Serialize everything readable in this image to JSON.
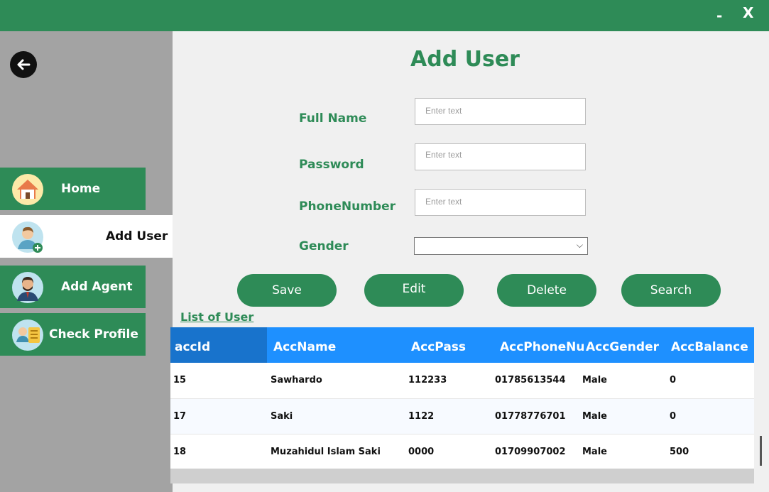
{
  "window": {
    "minimize_label": "-",
    "close_label": "X"
  },
  "sidebar": {
    "items": [
      {
        "label": "Home",
        "icon": "house-icon"
      },
      {
        "label": "Add User",
        "icon": "add-user-icon"
      },
      {
        "label": "Add Agent",
        "icon": "agent-icon"
      },
      {
        "label": "Check Profile",
        "icon": "profile-card-icon"
      }
    ]
  },
  "form": {
    "title": "Add User",
    "full_name_label": "Full Name",
    "full_name_placeholder": "Enter text",
    "password_label": "Password",
    "password_placeholder": "Enter text",
    "phone_label": "PhoneNumber",
    "phone_placeholder": "Enter text",
    "gender_label": "Gender",
    "gender_value": "",
    "dropdown_arrow": "⌵"
  },
  "buttons": {
    "save": "Save",
    "edit": "Edit",
    "delete": "Delete",
    "search": "Search"
  },
  "list": {
    "title": "List of User",
    "columns": [
      "accId",
      "AccName",
      "AccPass",
      "AccPhoneNumber",
      "AccGender",
      "AccBalance"
    ],
    "rows": [
      [
        "15",
        "Sawhardo",
        "112233",
        "01785613544",
        "Male",
        "0"
      ],
      [
        "17",
        "Saki",
        "1122",
        "01778776701",
        "Male",
        "0"
      ],
      [
        "18",
        "Muzahidul Islam Saki",
        "0000",
        "01709907002",
        "Male",
        "500"
      ]
    ]
  },
  "colors": {
    "brand_green": "#2e8b57",
    "header_blue": "#1e90ff",
    "sidebar_gray": "#a3a3a3"
  }
}
